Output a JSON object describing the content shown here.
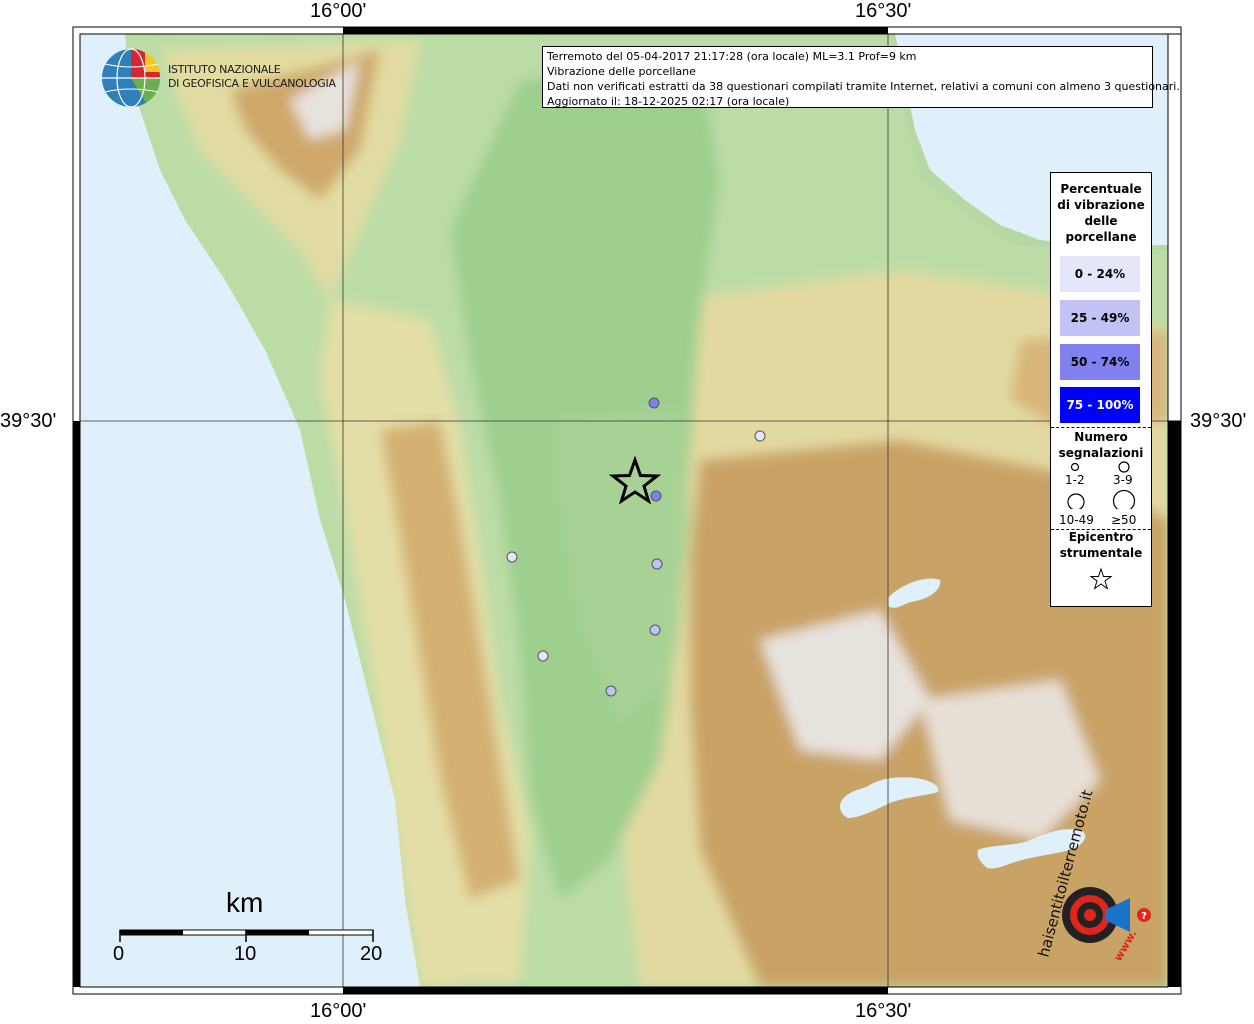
{
  "axes": {
    "lon_top": [
      "16°00'",
      "16°30'"
    ],
    "lon_bottom": [
      "16°00'",
      "16°30'"
    ],
    "lat_left": "39°30'",
    "lat_right": "39°30'"
  },
  "logo": {
    "line1": "ISTITUTO NAZIONALE",
    "line2": "DI GEOFISICA E VULCANOLOGIA"
  },
  "info": {
    "line1": "Terremoto del 05-04-2017 21:17:28 (ora locale) ML=3.1 Prof=9 km",
    "line2": "Vibrazione delle porcellane",
    "line3": "Dati non verificati estratti da 38 questionari compilati tramite Internet, relativi a comuni con almeno 3 questionari.",
    "line4": "Aggiornato il: 18-12-2025 02:17 (ora locale)"
  },
  "legend": {
    "title_lines": [
      "Percentuale",
      "di vibrazione",
      "delle",
      "porcellane"
    ],
    "classes": [
      {
        "label": "0 - 24%",
        "color": "#e6e6fa"
      },
      {
        "label": "25 - 49%",
        "color": "#c2c2f5"
      },
      {
        "label": "50 - 74%",
        "color": "#8080ee"
      },
      {
        "label": "75 - 100%",
        "color": "#0000ff"
      }
    ],
    "count_title_lines": [
      "Numero",
      "segnalazioni"
    ],
    "counts": [
      "1-2",
      "3-9",
      "10-49",
      "≥50"
    ],
    "epicenter_lines": [
      "Epicentro",
      "strumentale"
    ]
  },
  "observations": [
    {
      "class": 2,
      "size": "small"
    },
    {
      "class": 0,
      "size": "small"
    },
    {
      "class": 2,
      "size": "small"
    },
    {
      "class": 1,
      "size": "small"
    },
    {
      "class": 0,
      "size": "small"
    },
    {
      "class": 1,
      "size": "small"
    },
    {
      "class": 0,
      "size": "small"
    },
    {
      "class": 1,
      "size": "small"
    }
  ],
  "scale": {
    "unit": "km",
    "ticks": [
      "0",
      "10",
      "20"
    ]
  },
  "watermark": {
    "text": "haisentitoilterremoto.it",
    "sub": "www."
  },
  "colors": {
    "sea": "#dff0fa",
    "lowland": "#a9d49a",
    "hills": "#e3e0a8",
    "mountains": "#c8a164",
    "peaks": "#e9e4e2"
  }
}
